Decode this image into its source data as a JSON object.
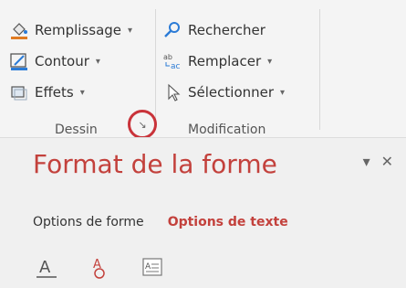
{
  "ribbon": {
    "dessin": {
      "label": "Dessin",
      "items": [
        {
          "label": "Remplissage",
          "icon": "paint-bucket-icon"
        },
        {
          "label": "Contour",
          "icon": "pen-outline-icon"
        },
        {
          "label": "Effets",
          "icon": "shape-effects-icon"
        }
      ]
    },
    "modification": {
      "label": "Modification",
      "items": [
        {
          "label": "Rechercher",
          "icon": "search-icon"
        },
        {
          "label": "Remplacer",
          "icon": "replace-icon"
        },
        {
          "label": "Sélectionner",
          "icon": "select-cursor-icon"
        }
      ]
    },
    "launcher_icon": "dialog-launcher-icon"
  },
  "pane": {
    "title": "Format de la forme",
    "tabs": [
      {
        "label": "Options de forme",
        "active": false
      },
      {
        "label": "Options de texte",
        "active": true
      }
    ],
    "tools": [
      "text-fill-outline-icon",
      "text-effects-icon",
      "textbox-icon"
    ]
  },
  "colors": {
    "accent": "#c3413c",
    "highlight_circle": "#c9333a"
  }
}
